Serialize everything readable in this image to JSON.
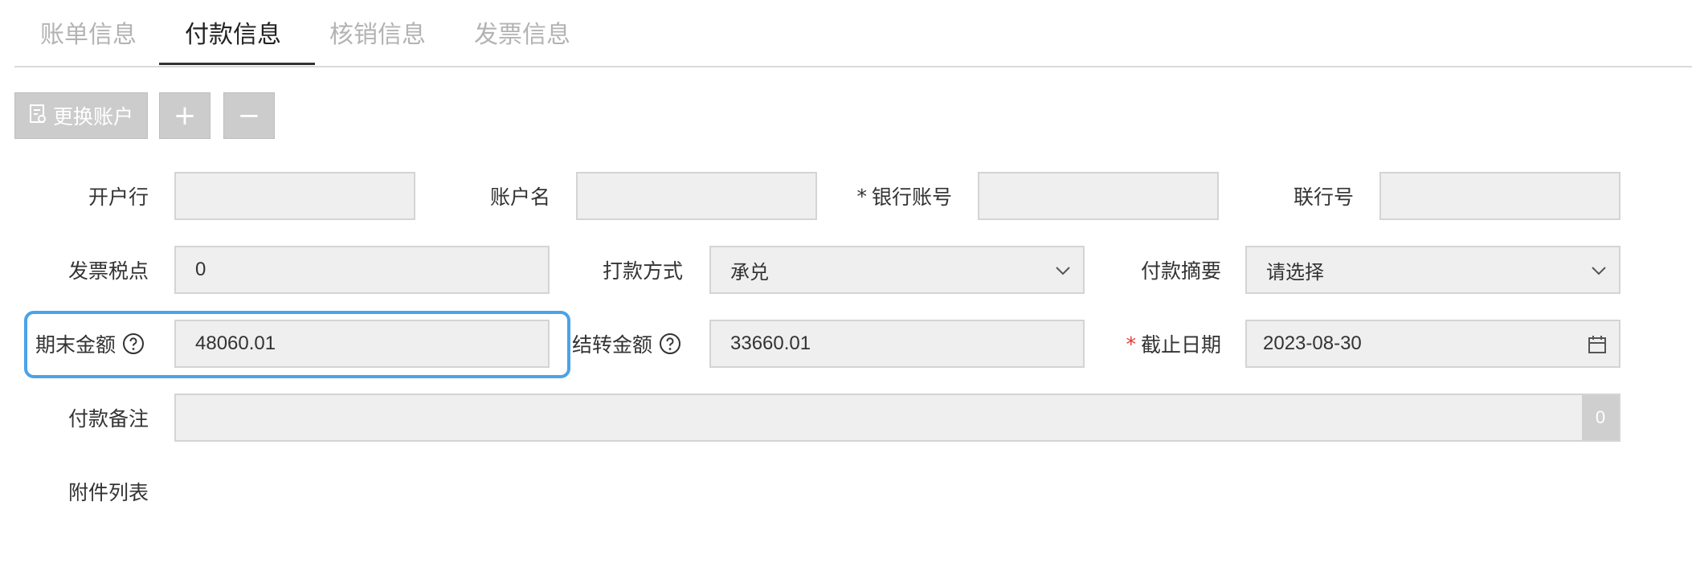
{
  "tabs": [
    {
      "label": "账单信息",
      "active": false
    },
    {
      "label": "付款信息",
      "active": true
    },
    {
      "label": "核销信息",
      "active": false
    },
    {
      "label": "发票信息",
      "active": false
    }
  ],
  "toolbar": {
    "change_account_label": "更换账户",
    "add_symbol": "+",
    "remove_symbol": "−"
  },
  "form": {
    "bank_branch": {
      "label": "开户行",
      "value": ""
    },
    "account_name": {
      "label": "账户名",
      "value": ""
    },
    "bank_account": {
      "label": "银行账号",
      "required_mark": "*",
      "value": ""
    },
    "interbank_no": {
      "label": "联行号",
      "value": ""
    },
    "invoice_tax_rate": {
      "label": "发票税点",
      "value": "0"
    },
    "payment_method": {
      "label": "打款方式",
      "value": "承兑"
    },
    "payment_summary": {
      "label": "付款摘要",
      "value": "请选择"
    },
    "closing_amount": {
      "label": "期末金额",
      "value": "48060.01"
    },
    "carryover_amount": {
      "label": "结转金额",
      "value": "33660.01"
    },
    "deadline_date": {
      "label": "截止日期",
      "required_mark": "*",
      "value": "2023-08-30"
    },
    "payment_remark": {
      "label": "付款备注",
      "value": "",
      "char_count": "0"
    },
    "attachments": {
      "label": "附件列表"
    }
  },
  "colors": {
    "highlight": "#4aa3e8",
    "required": "#e53935",
    "button_bg": "#cccccc",
    "field_bg": "#efefef"
  },
  "icons": [
    "document-icon",
    "help-icon",
    "chevron-down-icon",
    "calendar-icon"
  ]
}
